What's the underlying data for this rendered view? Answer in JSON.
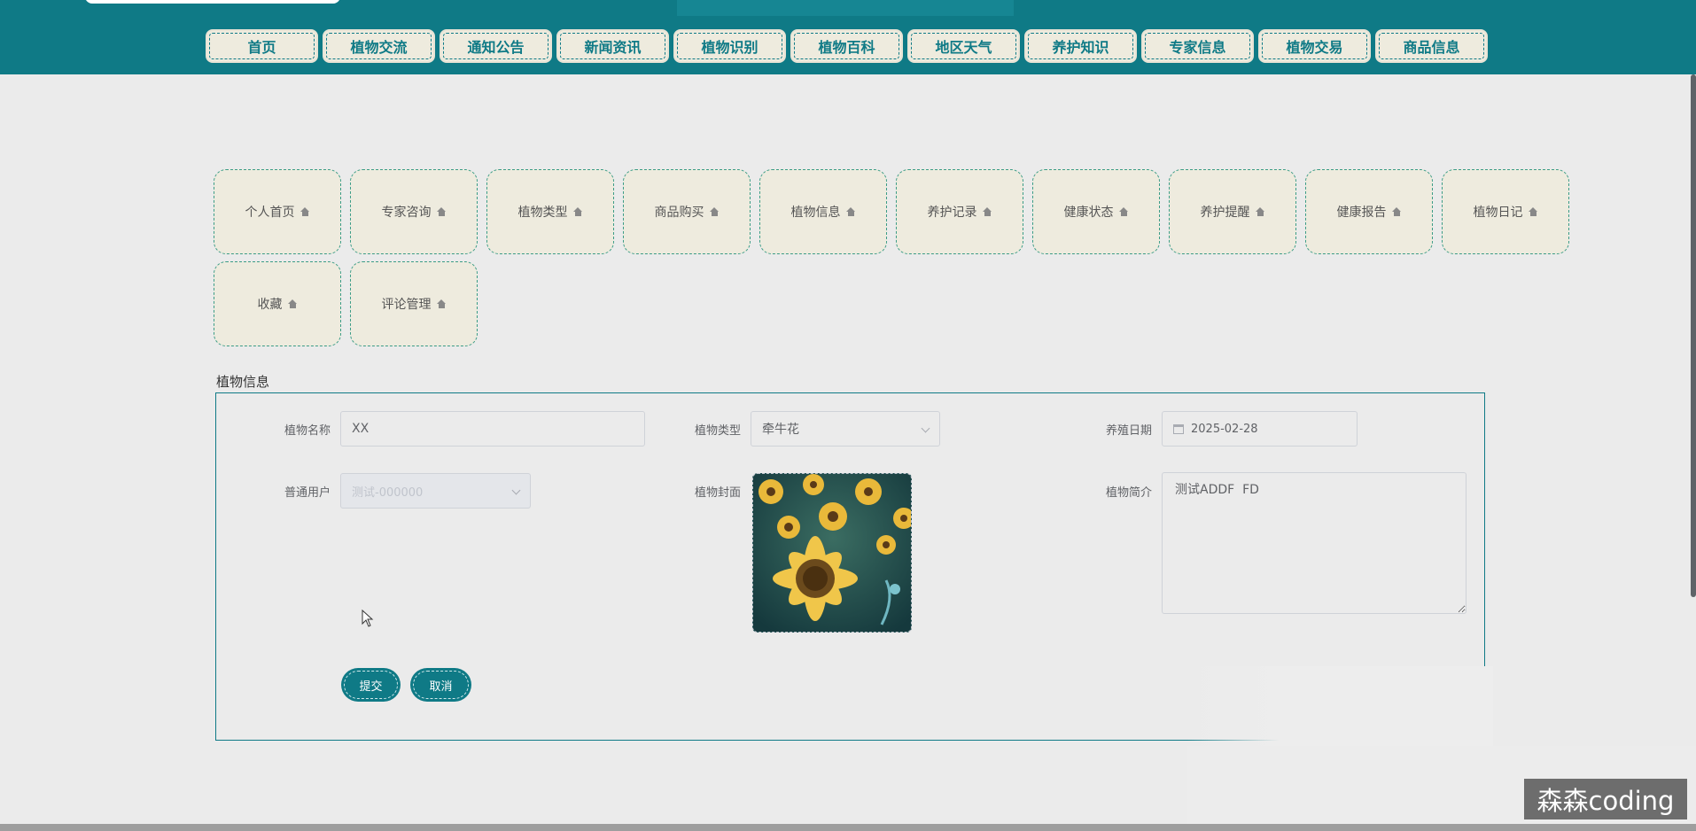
{
  "nav": {
    "items": [
      "首页",
      "植物交流",
      "通知公告",
      "新闻资讯",
      "植物识别",
      "植物百科",
      "地区天气",
      "养护知识",
      "专家信息",
      "植物交易",
      "商品信息"
    ]
  },
  "menu": {
    "items": [
      "个人首页",
      "专家咨询",
      "植物类型",
      "商品购买",
      "植物信息",
      "养护记录",
      "健康状态",
      "养护提醒",
      "健康报告",
      "植物日记",
      "收藏",
      "评论管理"
    ],
    "icon": "home-icon"
  },
  "form": {
    "section_title": "植物信息",
    "plant_name": {
      "label": "植物名称",
      "value": "XX"
    },
    "plant_type": {
      "label": "植物类型",
      "value": "牵牛花"
    },
    "plant_date": {
      "label": "养殖日期",
      "value": "2025-02-28"
    },
    "user": {
      "label": "普通用户",
      "value": "测试-000000"
    },
    "cover": {
      "label": "植物封面"
    },
    "intro": {
      "label": "植物简介",
      "value": "测试ADDF  FD"
    },
    "submit_label": "提交",
    "cancel_label": "取消"
  },
  "watermark": "森森coding",
  "colors": {
    "primary": "#0f7a86",
    "card_bg": "#eeebde",
    "page_bg": "#ebebeb"
  }
}
